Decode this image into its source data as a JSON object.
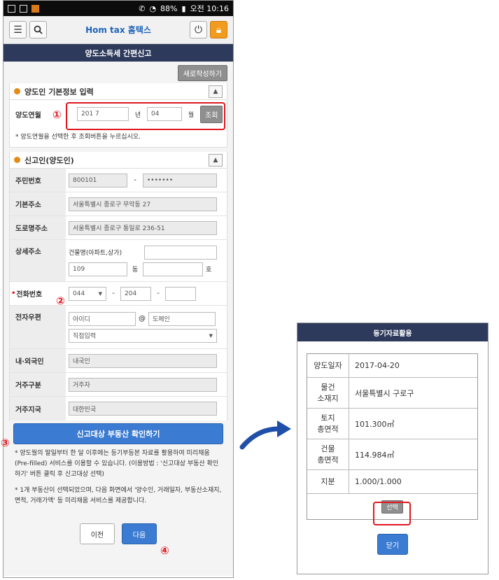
{
  "status_bar": {
    "battery": "88%",
    "time": "오전 10:16"
  },
  "header": {
    "logo": "Hom tax 홈택스",
    "title": "양도소득세 간편신고"
  },
  "new_write_button": "새로작성하기",
  "basic_info": {
    "title": "양도인 기본정보 입력",
    "month_label": "양도연월",
    "year_value": "201 7",
    "year_unit": "년",
    "month_value": "04",
    "month_unit": "월",
    "inquiry_button": "조회",
    "note": "* 양도연월을 선택한 후 조회버튼을 누르십시오."
  },
  "reporter": {
    "title": "신고인(양도인)",
    "rrn_label": "주민번호",
    "rrn_front": "800101",
    "rrn_back": "•••••••",
    "address_label": "기본주소",
    "address_value": "서울특별시 종로구 무악동 27",
    "road_label": "도로명주소",
    "road_value": "서울특별시 종로구 통일로 236-51",
    "detail_label": "상세주소",
    "building_label": "건물명(아파트,상가)",
    "dong_value": "109",
    "dong_unit": "동",
    "ho_unit": "호",
    "phone_label": "전화번호",
    "phone_1": "044",
    "phone_2": "204",
    "email_label": "전자우편",
    "email_id_placeholder": "아이디",
    "email_at": "@",
    "email_domain_placeholder": "도메인",
    "email_select": "직접입력",
    "nationality_label": "내·외국인",
    "nationality_value": "내국인",
    "residency_label": "거주구분",
    "residency_value": "거주자",
    "country_label": "거주지국",
    "country_value": "대한민국"
  },
  "confirm_button": "신고대상 부동산 확인하기",
  "note1": "* 양도월의 말일부터 한 달 이후에는 등기부등본 자료를 활용하여 미리채움(Pre-filled) 서비스를 이용할 수 있습니다. (이용방법 : '신고대상 부동산 확인하기' 버튼 클릭 후 신고대상 선택)",
  "note2": "* 1개 부동산이 선택되었으며, 다음 화면에서 '양수인, 거래일자, 부동산소재지, 면적, 거래가액' 등 미리채움 서비스를 제공합니다.",
  "prev_button": "이전",
  "next_button": "다음",
  "markers": [
    "①",
    "②",
    "③",
    "④"
  ],
  "popup": {
    "title": "등기자료활용",
    "rows": [
      {
        "label": "양도일자",
        "value": "2017-04-20"
      },
      {
        "label": "물건\n소재지",
        "value": "서울특별시 구로구"
      },
      {
        "label": "토지\n총면적",
        "value": "101.300㎡"
      },
      {
        "label": "건물\n총면적",
        "value": "114.984㎡"
      },
      {
        "label": "지분",
        "value": "1.000/1.000"
      }
    ],
    "select_button": "선택",
    "close_button": "닫기"
  },
  "colors": {
    "accent_red": "#e0171f",
    "header_navy": "#2d3a5c",
    "button_blue": "#3b7bd1",
    "bullet_orange": "#e48a16"
  }
}
